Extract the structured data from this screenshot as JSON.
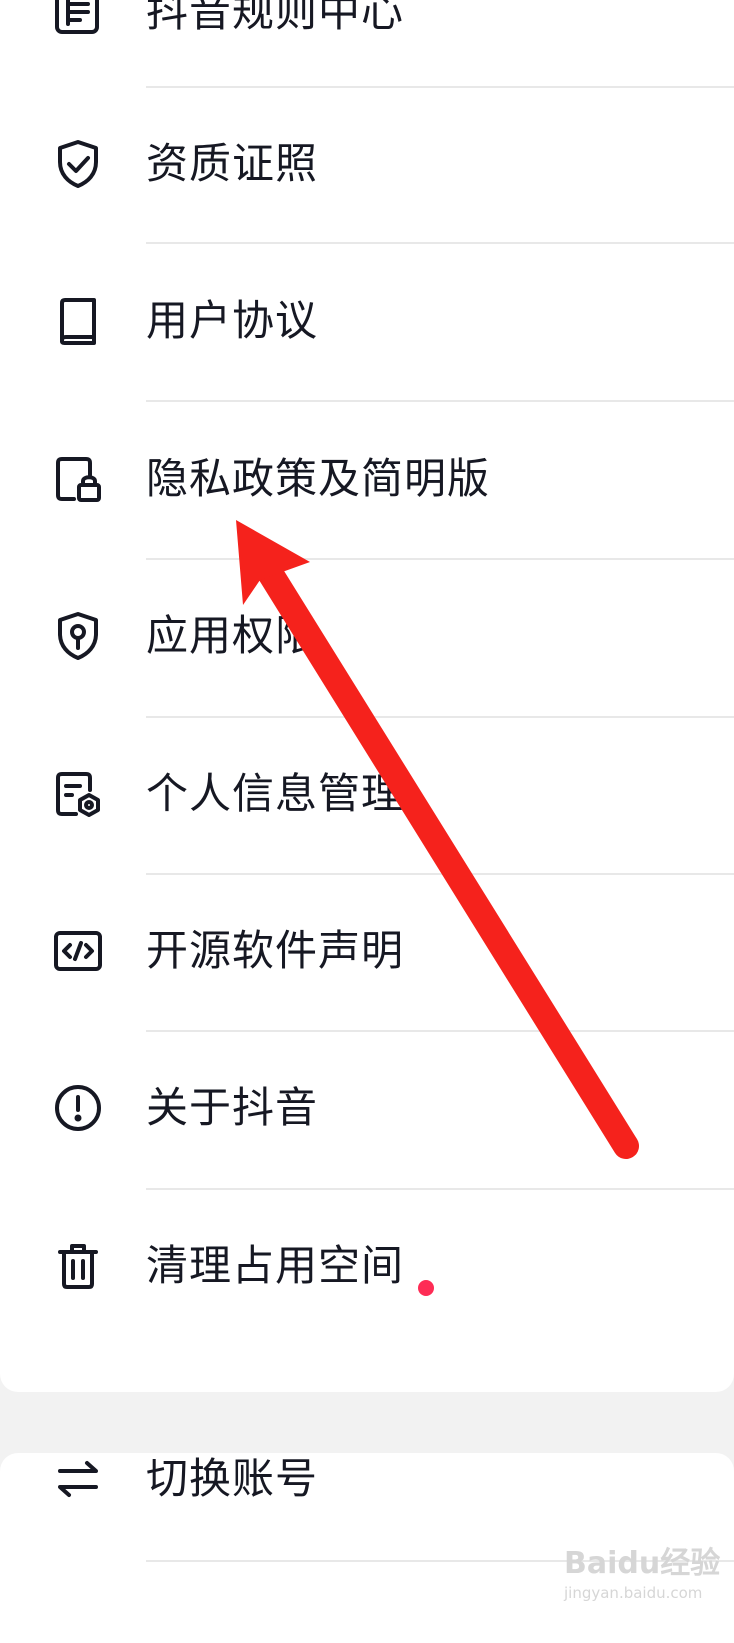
{
  "menu_top": {
    "items": [
      {
        "label": "抖音规则中心",
        "icon": "rules-document-icon"
      },
      {
        "label": "资质证照",
        "icon": "shield-check-icon"
      },
      {
        "label": "用户协议",
        "icon": "book-icon"
      },
      {
        "label": "隐私政策及简明版",
        "icon": "privacy-lock-icon"
      },
      {
        "label": "应用权限",
        "icon": "shield-key-icon"
      },
      {
        "label": "个人信息管理",
        "icon": "document-gear-icon"
      },
      {
        "label": "开源软件声明",
        "icon": "code-icon"
      },
      {
        "label": "关于抖音",
        "icon": "info-circle-icon"
      },
      {
        "label": "清理占用空间",
        "icon": "trash-icon",
        "badge": "dot"
      }
    ]
  },
  "menu_bottom": {
    "items": [
      {
        "label": "切换账号",
        "icon": "switch-arrows-icon"
      }
    ]
  },
  "annotation": {
    "type": "arrow",
    "color": "#f5221c",
    "points_to": "隐私政策及简明版"
  },
  "watermark": {
    "main": "Baidu经验",
    "sub": "jingyan.baidu.com"
  },
  "colors": {
    "badge": "#fe2c55",
    "text": "#161823",
    "background": "#f2f2f2"
  }
}
